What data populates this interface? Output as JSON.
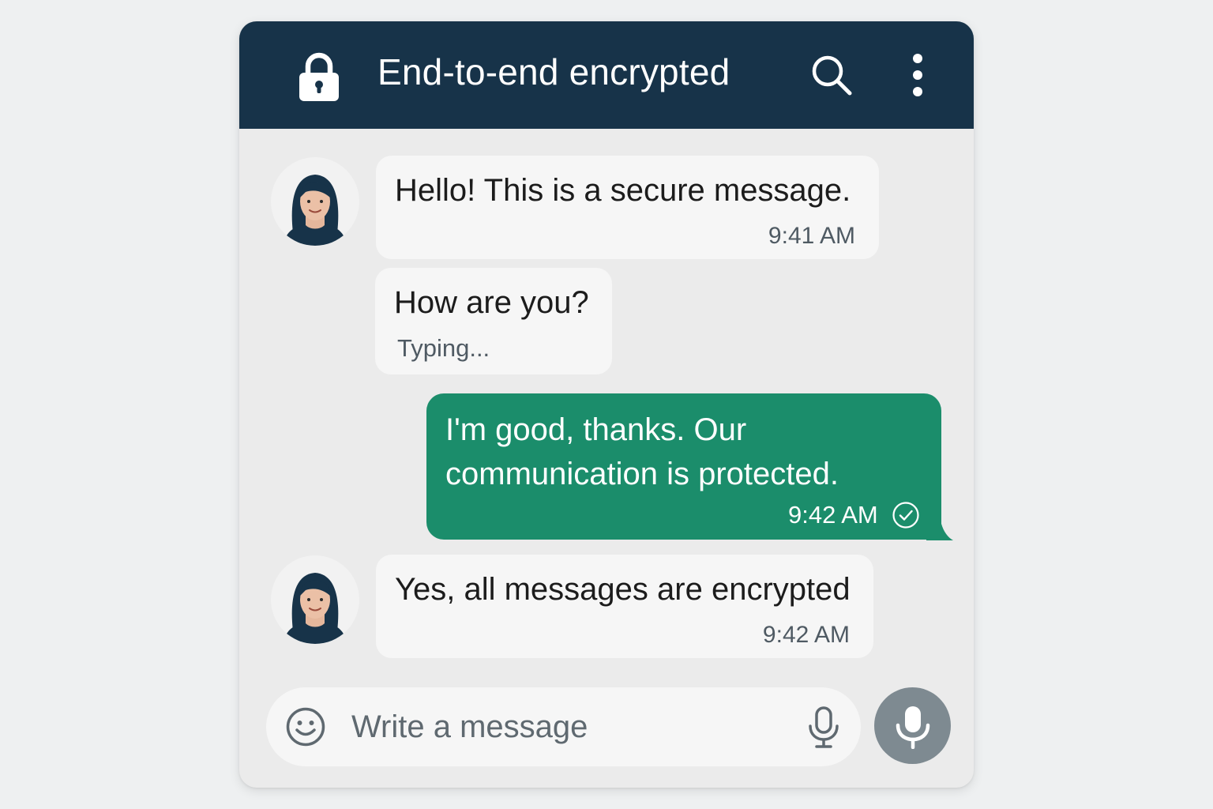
{
  "header": {
    "title": "End-to-end encrypted",
    "icons": [
      "lock-icon",
      "search-icon",
      "more-vertical-icon"
    ],
    "background_color": "#173349"
  },
  "messages": [
    {
      "direction": "incoming",
      "text": "Hello! This is a secure message.",
      "time": "9:41 AM",
      "has_avatar": true
    },
    {
      "direction": "incoming",
      "text": "How are you?",
      "status": "Typing...",
      "has_avatar": false
    },
    {
      "direction": "outgoing",
      "text": "I'm good, thanks. Our communication is protected.",
      "time": "9:42 AM",
      "status_icon": "check-circle-icon"
    },
    {
      "direction": "incoming",
      "text": "Yes, all messages are encrypted",
      "time": "9:42 AM",
      "has_avatar": true
    }
  ],
  "composer": {
    "placeholder": "Write a message",
    "icons": [
      "emoji-icon",
      "microphone-icon"
    ],
    "send_button_icon": "microphone-icon"
  },
  "colors": {
    "outgoing_bubble": "#1b8d6b",
    "incoming_bubble": "#f6f6f6",
    "chat_background": "#ebebeb",
    "mic_button": "#7e8a91"
  }
}
